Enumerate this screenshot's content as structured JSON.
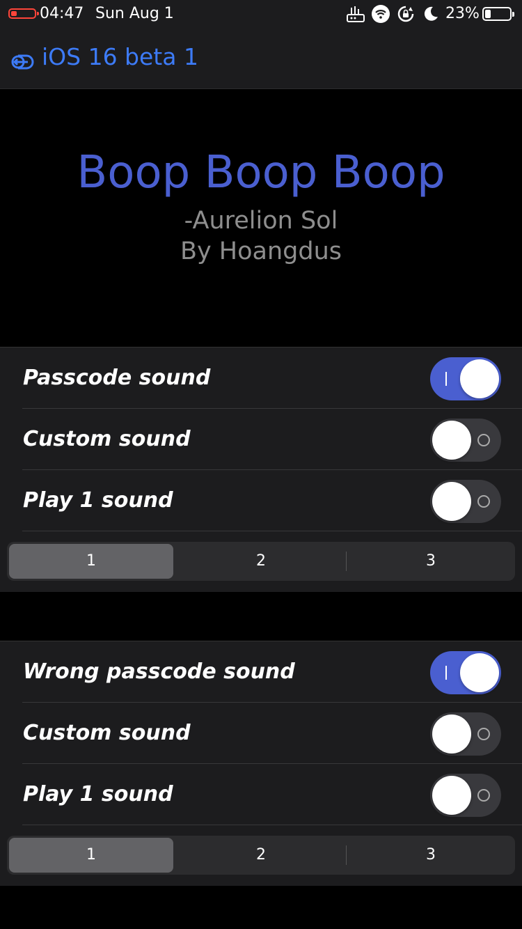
{
  "status": {
    "time": "04:47",
    "date": "Sun Aug 1",
    "battery_percent_label": "23%",
    "battery_level": 0.23,
    "icons": [
      "router-icon",
      "wifi-icon",
      "rotation-lock-icon",
      "moon-icon"
    ]
  },
  "nav": {
    "back_title": "iOS 16 beta 1"
  },
  "header": {
    "title": "Boop Boop Boop",
    "subtitle1": "-Aurelion Sol",
    "subtitle2": "By Hoangdus"
  },
  "groups": [
    {
      "rows": [
        {
          "label": "Passcode sound",
          "on": true
        },
        {
          "label": "Custom sound",
          "on": false
        },
        {
          "label": "Play 1 sound",
          "on": false
        }
      ],
      "segments": [
        "1",
        "2",
        "3"
      ],
      "selected_segment": "1"
    },
    {
      "rows": [
        {
          "label": "Wrong passcode sound",
          "on": true
        },
        {
          "label": "Custom sound",
          "on": false
        },
        {
          "label": "Play 1 sound",
          "on": false
        }
      ],
      "segments": [
        "1",
        "2",
        "3"
      ],
      "selected_segment": "1"
    }
  ],
  "colors": {
    "accent": "#4a5fd0",
    "link": "#3d7bf7",
    "low_battery": "#ff453a"
  }
}
